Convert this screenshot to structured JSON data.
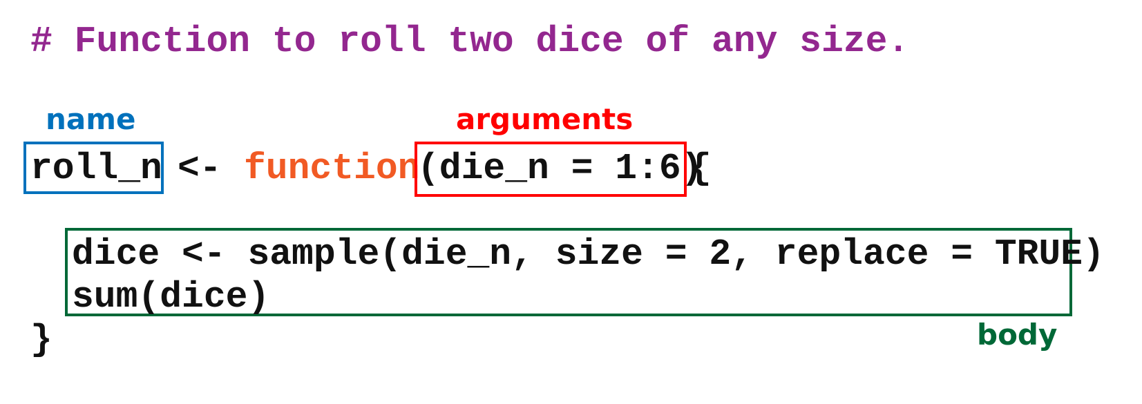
{
  "comment": "# Function to roll two dice of any size.",
  "header_line": {
    "name": "roll_n",
    "assign": "<-",
    "keyword": "function",
    "arguments": "(die_n = 1:6)",
    "open_brace": "{"
  },
  "body_lines": [
    "dice <- sample(die_n, size = 2, replace = TRUE)",
    "sum(dice)"
  ],
  "close_brace": "}",
  "labels": {
    "name": "name",
    "arguments": "arguments",
    "body": "body"
  },
  "colors": {
    "comment": "#93278F",
    "keyword": "#F15A24",
    "code": "#111111",
    "name_label": "#0071BC",
    "arguments_label": "#FF0000",
    "body_label": "#006837"
  }
}
